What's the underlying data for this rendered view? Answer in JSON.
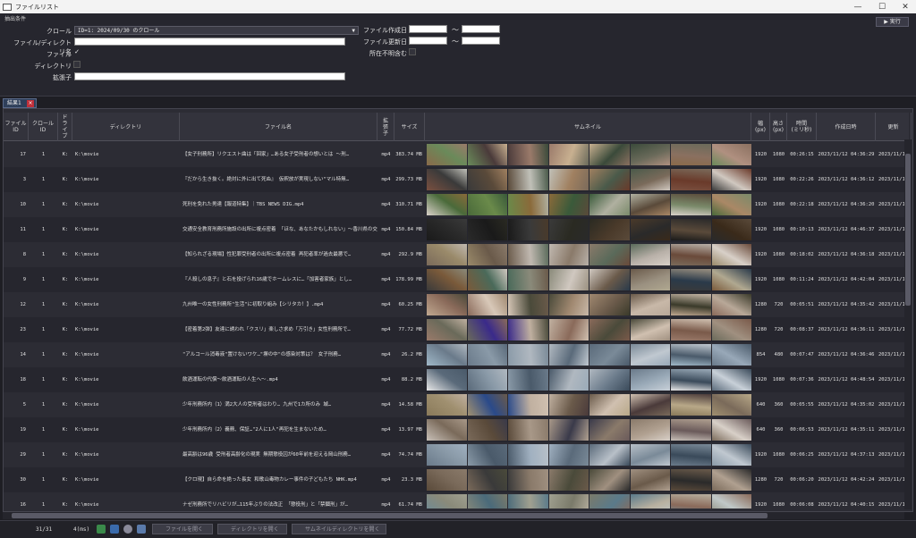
{
  "window": {
    "title": "ファイルリスト",
    "min": "—",
    "max": "☐",
    "close": "✕"
  },
  "filter": {
    "section_label": "抽出条件",
    "crawl_label": "クロール",
    "crawl_value": "ID=1: 2024/09/30 のクロール",
    "path_label": "ファイル/ディレクトリ名",
    "path_value": "",
    "file_label": "ファイル",
    "file_checked": "✓",
    "dir_label": "ディレクトリ",
    "dir_checked": "",
    "ext_label": "拡張子",
    "ext_value": "",
    "created_label": "ファイル作成日",
    "updated_label": "ファイル更新日",
    "tilde": "～",
    "unknown_label": "所在不明含む",
    "exec_label": "▶ 実行"
  },
  "tab": {
    "label": "結果1",
    "close": "×"
  },
  "columns": [
    {
      "label": "ファイル\nID"
    },
    {
      "label": "クロール\nID"
    },
    {
      "label": "ド\nラ\nイ\nブ"
    },
    {
      "label": "ディレクトリ"
    },
    {
      "label": "ファイル名"
    },
    {
      "label": "拡\n張\n子"
    },
    {
      "label": "サイズ"
    },
    {
      "label": "サムネイル"
    },
    {
      "label": "幅\n(px)"
    },
    {
      "label": "高さ\n(px)"
    },
    {
      "label": "時間\n(ミリ秒)"
    },
    {
      "label": "作成日時"
    },
    {
      "label": "更新"
    }
  ],
  "rows": [
    {
      "id": "17",
      "crawl": "1",
      "drive": "K:",
      "dir": "K:\\movie",
      "name": "【女子刑務所】リクエスト曲は「回家」…ある女子受刑者の想いとは ～刑…",
      "ext": "mp4",
      "size": "383.74 MB",
      "w": "1920",
      "h": "1080",
      "dur": "00:26:15",
      "created": "2023/11/12 04:36:29",
      "updated": "2023/11/12"
    },
    {
      "id": "3",
      "crawl": "1",
      "drive": "K:",
      "dir": "K:\\movie",
      "name": "『だから生き抜く。絶対に外に出て死ぬ』 仮釈放が実現しない\"マル特無…",
      "ext": "mp4",
      "size": "299.73 MB",
      "w": "1920",
      "h": "1080",
      "dur": "00:22:26",
      "created": "2023/11/12 04:36:12",
      "updated": "2023/11/12"
    },
    {
      "id": "10",
      "crawl": "1",
      "drive": "K:",
      "dir": "K:\\movie",
      "name": "死刑を免れた男達【報道特集】｜TBS NEWS DIG.mp4",
      "ext": "mp4",
      "size": "310.71 MB",
      "w": "1920",
      "h": "1080",
      "dur": "00:22:18",
      "created": "2023/11/12 04:36:20",
      "updated": "2023/11/12"
    },
    {
      "id": "11",
      "crawl": "1",
      "drive": "K:",
      "dir": "K:\\movie",
      "name": "交通安全教育刑務所施設の出所に複点密着 「ほな、あなたかもしれない」～香川県の交通安…",
      "ext": "mp4",
      "size": "150.84 MB",
      "w": "1920",
      "h": "1080",
      "dur": "00:10:13",
      "created": "2023/11/12 04:46:37",
      "updated": "2023/11/12"
    },
    {
      "id": "8",
      "crawl": "1",
      "drive": "K:",
      "dir": "K:\\movie",
      "name": "【知られざる現場】性犯罪受刑者の出所に複点密着 再犯者率が過去最悪で…",
      "ext": "mp4",
      "size": "292.9 MB",
      "w": "1920",
      "h": "1080",
      "dur": "00:18:02",
      "created": "2023/11/12 04:36:18",
      "updated": "2023/11/12"
    },
    {
      "id": "9",
      "crawl": "1",
      "drive": "K:",
      "dir": "K:\\movie",
      "name": "『人殺しの息子』と石を投げられ16歳でホームレスに…「加害者家族」とし…",
      "ext": "mp4",
      "size": "178.99 MB",
      "w": "1920",
      "h": "1080",
      "dur": "00:11:24",
      "created": "2023/11/12 04:42:04",
      "updated": "2023/11/12"
    },
    {
      "id": "12",
      "crawl": "1",
      "drive": "K:",
      "dir": "K:\\movie",
      "name": "九州唯一の女性刑務所\"生活\"に初取り組み【シリタカ！】.mp4",
      "ext": "mp4",
      "size": "60.25 MB",
      "w": "1280",
      "h": "720",
      "dur": "00:05:51",
      "created": "2023/11/12 04:35:42",
      "updated": "2023/11/12"
    },
    {
      "id": "23",
      "crawl": "1",
      "drive": "K:",
      "dir": "K:\\movie",
      "name": "【密着第2弾】友達に誘われ「クスリ」楽しさ求め「万引き」女性刑務所で…",
      "ext": "mp4",
      "size": "77.72 MB",
      "w": "1280",
      "h": "720",
      "dur": "00:08:37",
      "created": "2023/11/12 04:36:11",
      "updated": "2023/11/12"
    },
    {
      "id": "14",
      "crawl": "1",
      "drive": "K:",
      "dir": "K:\\movie",
      "name": "\"アルコール消毒液\"置けないワケ…\"塀の中\"の感染対策は？ 女子刑務…",
      "ext": "mp4",
      "size": "26.2 MB",
      "w": "854",
      "h": "480",
      "dur": "00:07:47",
      "created": "2023/11/12 04:36:46",
      "updated": "2023/11/12"
    },
    {
      "id": "18",
      "crawl": "1",
      "drive": "K:",
      "dir": "K:\\movie",
      "name": "飲酒運転の代償～飲酒運転の人生へ～.mp4",
      "ext": "mp4",
      "size": "88.2 MB",
      "w": "1920",
      "h": "1080",
      "dur": "00:07:36",
      "created": "2023/11/12 04:48:54",
      "updated": "2023/11/12"
    },
    {
      "id": "5",
      "crawl": "1",
      "drive": "K:",
      "dir": "K:\\movie",
      "name": "少年刑務所内（1）満2大人の受刑者はわり… 九州で1カ所のみ 城…",
      "ext": "mp4",
      "size": "14.58 MB",
      "w": "640",
      "h": "360",
      "dur": "00:05:55",
      "created": "2023/11/12 04:35:02",
      "updated": "2023/11/12"
    },
    {
      "id": "19",
      "crawl": "1",
      "drive": "K:",
      "dir": "K:\\movie",
      "name": "少年刑務所内（2）義務、保証…\"2人に1人\"再犯を生まないため…",
      "ext": "mp4",
      "size": "13.97 MB",
      "w": "640",
      "h": "360",
      "dur": "00:06:53",
      "created": "2023/11/12 04:35:11",
      "updated": "2023/11/12"
    },
    {
      "id": "29",
      "crawl": "1",
      "drive": "K:",
      "dir": "K:\\movie",
      "name": "最高齢は96歳 受刑者高齢化の現実 無期懲役囚が60年前を迎える岡山刑務…",
      "ext": "mp4",
      "size": "74.74 MB",
      "w": "1920",
      "h": "1080",
      "dur": "00:06:25",
      "created": "2023/11/12 04:37:13",
      "updated": "2023/11/12"
    },
    {
      "id": "30",
      "crawl": "1",
      "drive": "K:",
      "dir": "K:\\movie",
      "name": "【クロ現】自ら命を絶った長女 和歌山毒物カレー事件の子どもたち NHK.mp4",
      "ext": "mp4",
      "size": "23.3 MB",
      "w": "1280",
      "h": "720",
      "dur": "00:06:20",
      "created": "2023/11/12 04:42:24",
      "updated": "2023/11/12"
    },
    {
      "id": "16",
      "crawl": "1",
      "drive": "K:",
      "dir": "K:\\movie",
      "name": "ナゼ刑務所でリハビリが…115年ぶりの法改正 「懲役刑」と「禁錮刑」が…",
      "ext": "mp4",
      "size": "61.74 MB",
      "w": "1920",
      "h": "1080",
      "dur": "00:06:08",
      "created": "2023/11/12 04:40:15",
      "updated": "2023/11/12"
    }
  ],
  "status": {
    "count": "31/31",
    "time": "4(ms)",
    "open_file": "ファイルを開く",
    "open_dir": "ディレクトリを開く",
    "open_thumb": "サムネイルディレクトリを開く"
  },
  "colors": {
    "row_even": "#2c2c34",
    "row_odd": "#26262e",
    "accent": "#2f3f5a"
  },
  "thumb_colors": [
    [
      "#8a6a4a",
      "#6a8a5a",
      "#4a3a3a",
      "#9a7a6a",
      "#c8b090",
      "#3a4a3a",
      "#6a6a5a",
      "#8a7060",
      "#b09080"
    ],
    [
      "#7a5040",
      "#3a3a3a",
      "#5a4a3a",
      "#c0c0b8",
      "#a08060",
      "#4a5a4a",
      "#7a6a5a",
      "#6a3a2a",
      "#d0c8c0"
    ],
    [
      "#d8d0c8",
      "#4a6a3a",
      "#6a8a4a",
      "#8a6a3a",
      "#3a5a3a",
      "#b0b0a0",
      "#5a4a3a",
      "#7a8a6a",
      "#aa8866"
    ],
    [
      "#1a1a1a",
      "#2a2a2a",
      "#1a1a1a",
      "#3a3a3a",
      "#2a2a22",
      "#4a3a2a",
      "#2a2a2a",
      "#5a4a3a",
      "#3a2a1a"
    ],
    [
      "#7a6a5a",
      "#9a8a6a",
      "#6a5a4a",
      "#c0b8b0",
      "#8a7a6a",
      "#5a6a5a",
      "#b8b0a8",
      "#6a4a3a",
      "#d8d0c8"
    ],
    [
      "#3a3a3a",
      "#7a5a3a",
      "#4a6a5a",
      "#8a8a7a",
      "#d0c8c0",
      "#6a5a4a",
      "#9a9080",
      "#2a3a4a",
      "#b0a890"
    ],
    [
      "#c0a890",
      "#8a6a5a",
      "#d8c8b8",
      "#4a4a3a",
      "#a08870",
      "#6a5a4a",
      "#c8b8a8",
      "#3a3a2a",
      "#b8a898"
    ],
    [
      "#9a7a6a",
      "#6a6a5a",
      "#3a2a8a",
      "#c0b0a0",
      "#8a6a5a",
      "#4a4a3a",
      "#d0c0b0",
      "#7a5a4a",
      "#a09080"
    ],
    [
      "#a0b8c8",
      "#6a7a8a",
      "#8a9aa8",
      "#b0b8c0",
      "#5a6a7a",
      "#7a8a98",
      "#c0c8d0",
      "#4a5a6a",
      "#98a8b8"
    ],
    [
      "#e8e8e8",
      "#5a6a7a",
      "#8a9aa8",
      "#4a5a6a",
      "#b0b8c0",
      "#6a7a8a",
      "#9aaab8",
      "#3a4a5a",
      "#c8d0d8"
    ],
    [
      "#8a7a5a",
      "#a09070",
      "#2a4a8a",
      "#c0b0a0",
      "#6a5a4a",
      "#d0c0b0",
      "#4a3a3a",
      "#b8a888",
      "#7a6a5a"
    ],
    [
      "#c8c0b8",
      "#7a6a5a",
      "#5a4a3a",
      "#a89888",
      "#3a3a4a",
      "#8a7a6a",
      "#b0a090",
      "#6a5a5a",
      "#d8d0c8"
    ],
    [
      "#6a7a8a",
      "#8a9aa8",
      "#4a5a6a",
      "#a0b0c0",
      "#5a6a7a",
      "#b8c0c8",
      "#7a8a98",
      "#3a4a5a",
      "#c0c8d0"
    ],
    [
      "#5a4a3a",
      "#7a6a5a",
      "#3a3a3a",
      "#8a7a6a",
      "#4a4a3a",
      "#a09080",
      "#6a5a4a",
      "#2a2a2a",
      "#b0a090"
    ],
    [
      "#6a8a9a",
      "#8a8a7a",
      "#4a6a7a",
      "#a0a090",
      "#7a7a6a",
      "#5a7a8a",
      "#b8b0a0",
      "#8a6a5a",
      "#c0c8c8"
    ]
  ]
}
